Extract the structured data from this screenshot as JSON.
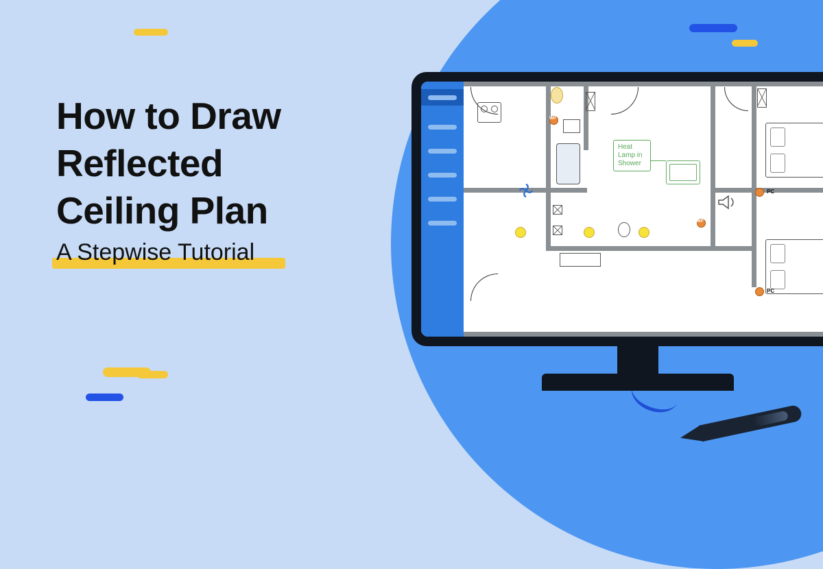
{
  "title": {
    "line1": "How to Draw",
    "line2": "Reflected",
    "line3": "Ceiling Plan"
  },
  "subtitle": "A Stepwise Tutorial",
  "annotation": {
    "label": "Heat Lamp in Shower"
  },
  "symbols": {
    "pc1": "PC",
    "pc2": "PC",
    "wp1": "WP",
    "wp2": "WP"
  },
  "colors": {
    "bg": "#c7dbf6",
    "circle": "#4d97f2",
    "accent_blue": "#2352e6",
    "accent_yellow": "#f5c83a",
    "wall": "#8a8f93"
  }
}
